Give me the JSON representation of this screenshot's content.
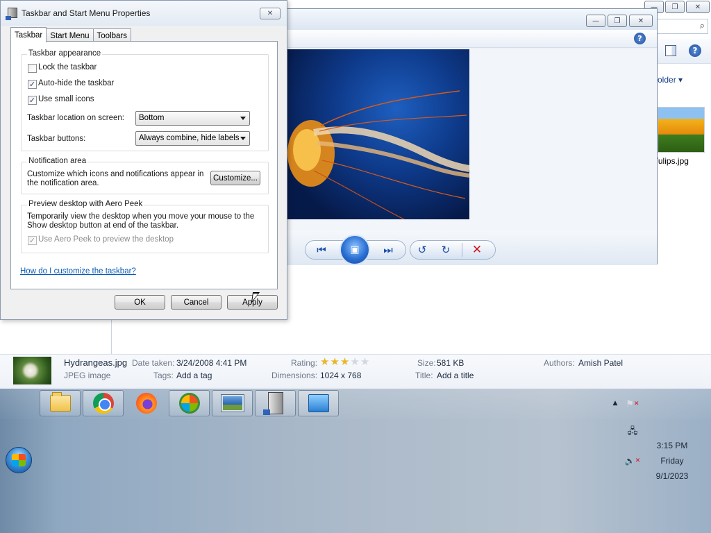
{
  "dialog": {
    "title": "Taskbar and Start Menu Properties",
    "close_glyph": "✕",
    "tabs": [
      "Taskbar",
      "Start Menu",
      "Toolbars"
    ],
    "appearance": {
      "group_label": "Taskbar appearance",
      "lock_label": "Lock the taskbar",
      "lock_checked": false,
      "autohide_label": "Auto-hide the taskbar",
      "autohide_checked": true,
      "small_icons_label": "Use small icons",
      "small_icons_checked": true,
      "location_label": "Taskbar location on screen:",
      "location_value": "Bottom",
      "buttons_label": "Taskbar buttons:",
      "buttons_value": "Always combine, hide labels"
    },
    "notification": {
      "group_label": "Notification area",
      "description": "Customize which icons and notifications appear in the notification area.",
      "customize_button": "Customize..."
    },
    "aero_peek": {
      "group_label": "Preview desktop with Aero Peek",
      "description": "Temporarily view the desktop when you move your mouse to the Show desktop button at end of the taskbar.",
      "checkbox_label": "Use Aero Peek to preview the desktop",
      "checked": true,
      "disabled": true
    },
    "help_link": "How do I customize the taskbar?",
    "ok_button": "OK",
    "cancel_button": "Cancel",
    "apply_button": "Apply"
  },
  "explorer": {
    "caption_glyphs": [
      "—",
      "❐",
      "✕"
    ],
    "search_icon": "⌕",
    "help_glyph": "?",
    "folder_button": "older ▾",
    "thumbnail_label": "Tulips.jpg"
  },
  "viewer": {
    "caption_glyphs": [
      "—",
      "❐",
      "✕"
    ],
    "help_glyph": "?",
    "controls": {
      "prev_glyph": "⏮",
      "slideshow_glyph": "▣",
      "next_glyph": "⏭",
      "rotate_ccw_glyph": "↺",
      "rotate_cw_glyph": "↻",
      "delete_glyph": "✕"
    }
  },
  "details": {
    "filename": "Hydrangeas.jpg",
    "filetype": "JPEG image",
    "date_taken_label": "Date taken:",
    "date_taken_value": "3/24/2008 4:41 PM",
    "tags_label": "Tags:",
    "tags_value": "Add a tag",
    "rating_label": "Rating:",
    "rating_value": 3,
    "rating_max": 5,
    "dimensions_label": "Dimensions:",
    "dimensions_value": "1024 x 768",
    "size_label": "Size:",
    "size_value": "581 KB",
    "title_label": "Title:",
    "title_value": "Add a title",
    "authors_label": "Authors:",
    "authors_value": "Amish Patel"
  },
  "taskbar": {
    "buttons": [
      "folder-icon",
      "chrome-icon",
      "firefox-icon",
      "windows-update-icon",
      "photo-viewer-icon",
      "computer-icon",
      "control-panel-icon"
    ],
    "tray": {
      "overflow_glyph": "▲",
      "action_center_glyph": "⚑",
      "network_glyph": "🖧",
      "volume_glyph": "🔈",
      "x_glyph": "✕"
    },
    "clock": {
      "time": "3:15 PM",
      "day": "Friday",
      "date": "9/1/2023"
    }
  },
  "colors": {
    "link": "#0a5bb5",
    "delete_red": "#c8141a",
    "star_gold": "#e9b628"
  }
}
